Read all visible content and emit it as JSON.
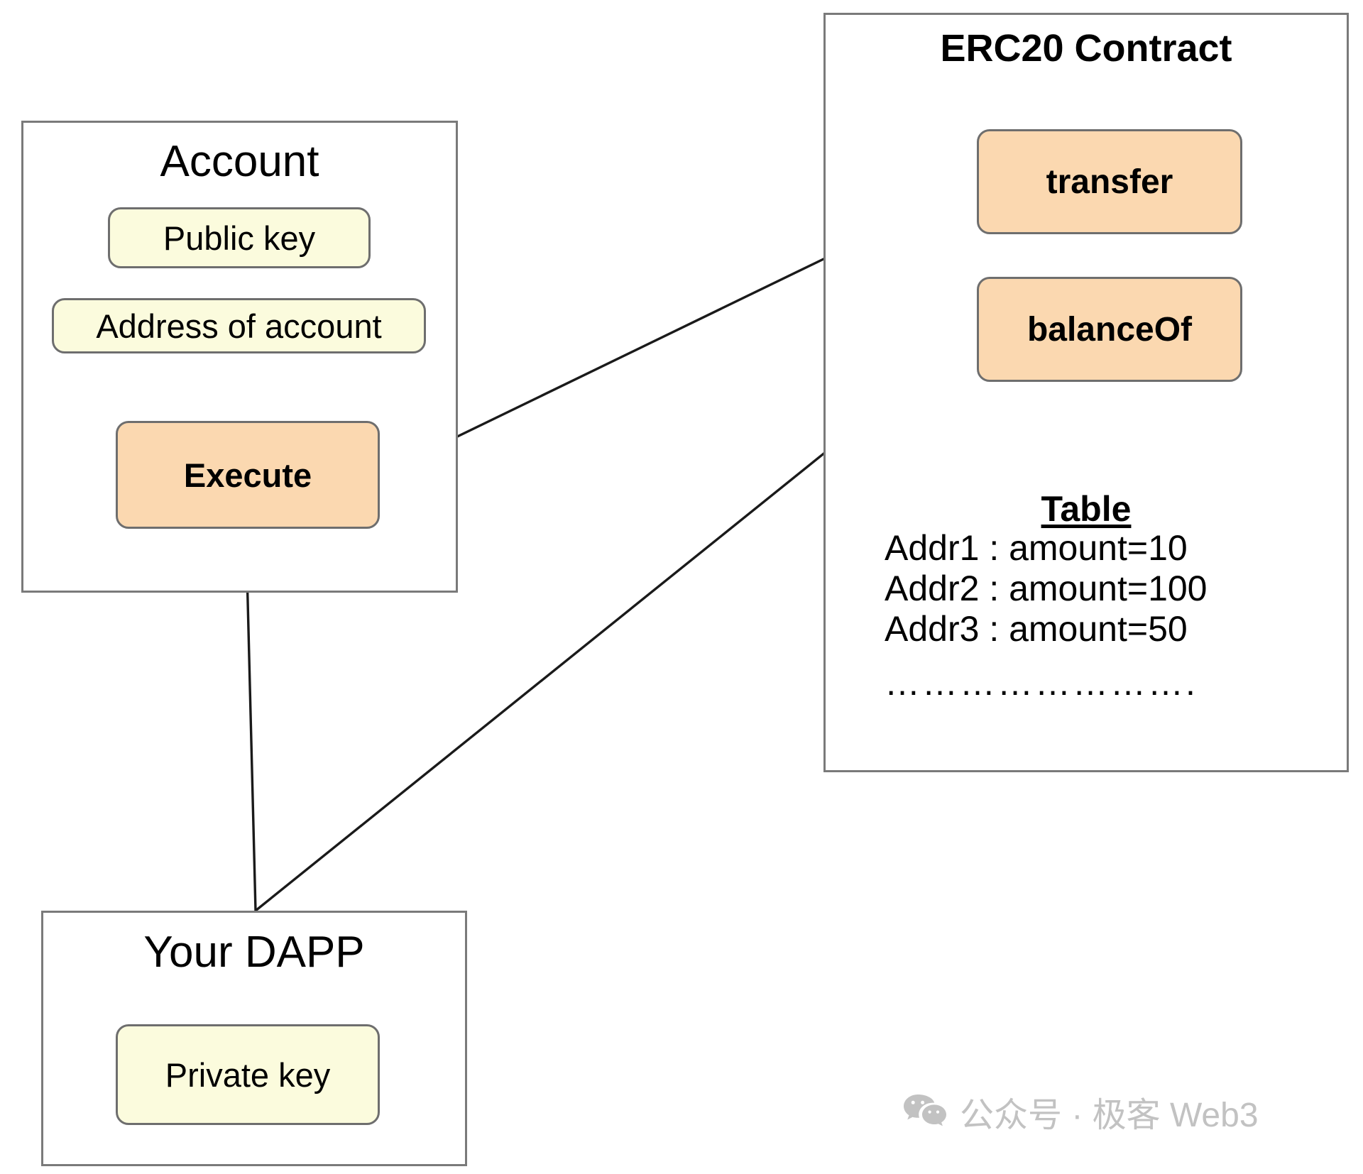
{
  "colors": {
    "background": "#ffffff",
    "box_border": "#7a7a7a",
    "node_border": "#6e6e6e",
    "yellow_fill": "#fbfbdd",
    "orange_fill": "#fbd8b0",
    "arrow_stroke": "#1a1a1a",
    "watermark": "#c2c2c2",
    "text": "#000000"
  },
  "account": {
    "title": "Account",
    "public_key_label": "Public key",
    "address_label": "Address of account",
    "execute_label": "Execute"
  },
  "dapp": {
    "title": "Your DAPP",
    "private_key_label": "Private key"
  },
  "erc20": {
    "title": "ERC20 Contract",
    "transfer_label": "transfer",
    "balanceof_label": "balanceOf",
    "table": {
      "heading": "Table",
      "rows": [
        "Addr1 : amount=10",
        "Addr2 : amount=100",
        "Addr3 : amount=50"
      ],
      "ellipsis": "……………………."
    }
  },
  "arrows": [
    {
      "name": "dapp-to-execute",
      "from": "Your DAPP",
      "to": "Execute"
    },
    {
      "name": "execute-to-transfer",
      "from": "Execute",
      "to": "transfer"
    },
    {
      "name": "dapp-to-balanceof",
      "from": "Your DAPP",
      "to": "balanceOf"
    }
  ],
  "watermark": {
    "icon": "wechat-icon",
    "text": "公众号 · 极客 Web3"
  }
}
